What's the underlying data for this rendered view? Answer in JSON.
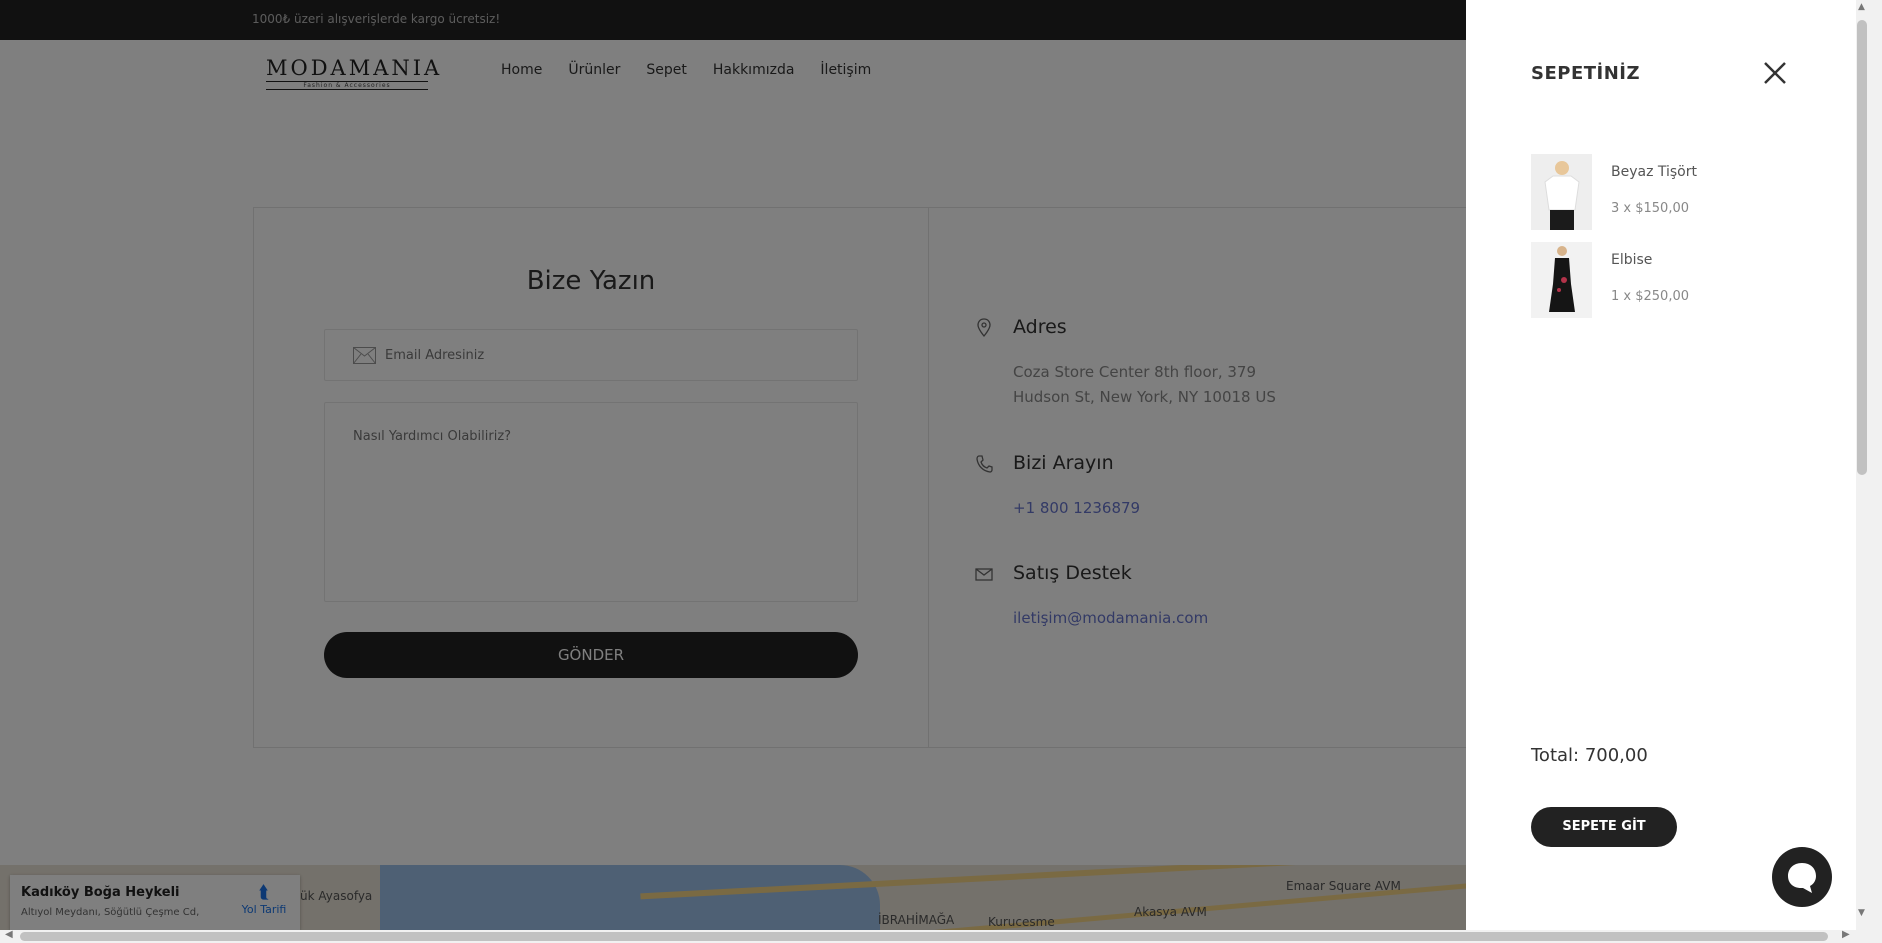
{
  "topbar": {
    "promo": "1000₺ üzeri alışverişlerde kargo ücretsiz!"
  },
  "header": {
    "brand": "MODAMANIA",
    "tagline": "Fashion & Accessories",
    "nav": [
      "Home",
      "Ürünler",
      "Sepet",
      "Hakkımızda",
      "İletişim"
    ]
  },
  "contact_form": {
    "title": "Bize Yazın",
    "email_placeholder": "Email Adresiniz",
    "message_placeholder": "Nasıl Yardımcı Olabiliriz?",
    "submit_label": "GÖNDER"
  },
  "contact_info": {
    "address": {
      "title": "Adres",
      "line1": "Coza Store Center 8th floor, 379",
      "line2": "Hudson St, New York, NY 10018 US",
      "icon": "map-pin-icon"
    },
    "phone": {
      "title": "Bizi Arayın",
      "value": "+1 800 1236879",
      "icon": "phone-icon"
    },
    "email": {
      "title": "Satış Destek",
      "value": "iletişim@modamania.com",
      "icon": "mail-icon"
    }
  },
  "map": {
    "place_name": "Kadıköy Boğa Heykeli",
    "place_address": "Altıyol Meydanı, Söğütlü Çeşme Cd,",
    "route_label": "Yol Tarifi",
    "labels": [
      "ük Ayasofya",
      "İBRAHİMAĞA",
      "Kurucesme",
      "Akasya AVM",
      "Emaar Square AVM"
    ]
  },
  "cart": {
    "title": "SEPETİNİZ",
    "items": [
      {
        "name": "Beyaz Tişört",
        "qty_price": "3 x $150,00"
      },
      {
        "name": "Elbise",
        "qty_price": "1 x $250,00"
      }
    ],
    "total": "Total: 700,00",
    "button_label": "SEPETE GİT"
  },
  "colors": {
    "dark": "#222222",
    "link": "#6674cc",
    "overlay": "rgba(0,0,0,0.5)"
  }
}
